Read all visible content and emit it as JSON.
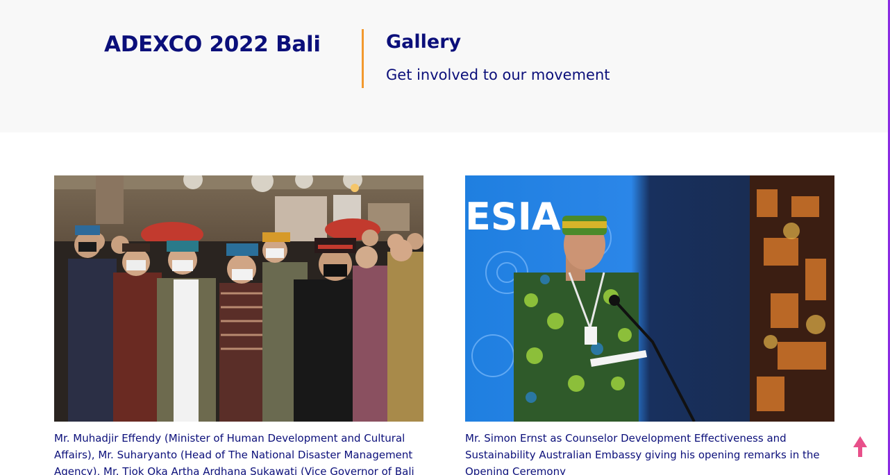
{
  "header": {
    "site_title": "ADEXCO 2022 Bali",
    "section_title": "Gallery",
    "section_subtitle": "Get involved to our movement"
  },
  "gallery": [
    {
      "caption": "Mr. Muhadjir Effendy (Minister of Human Development and Cultural Affairs), Mr. Suharyanto (Head of The National Disaster Management Agency), Mr. Tjok Oka Artha Ardhana Sukawati (Vice Governor of Bali"
    },
    {
      "caption": "Mr. Simon Ernst as Counselor Development Effectiveness and Sustainability Australian Embassy giving his opening remarks in the Opening Ceremony",
      "backdrop_text": "ESIA"
    }
  ],
  "colors": {
    "brand": "#0b0f7a",
    "accent": "#f2992e",
    "scroll_top": "#e8508a"
  },
  "icons": {
    "scroll_top": "arrow-up-icon"
  }
}
